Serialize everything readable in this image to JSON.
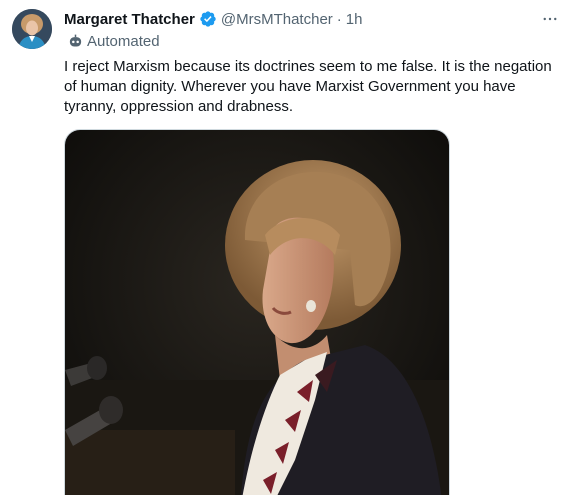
{
  "author": {
    "name": "Margaret Thatcher",
    "handle": "@MrsMThatcher",
    "separator": "·",
    "time": "1h",
    "verified": true,
    "label": "Automated",
    "label_icon": "bot-icon"
  },
  "tweet": {
    "lines": [
      "I reject Marxism because its doctrines seem to me false. It is the negation",
      "of human dignity. Wherever you have Marxist Government you have",
      "tyranny, oppression and drabness."
    ]
  },
  "media": {
    "subject": "photo"
  },
  "icons": {
    "verified": "verified-badge-icon",
    "more": "more-options-icon"
  },
  "colors": {
    "accent": "#1d9bf0",
    "secondary_text": "#536471",
    "primary_text": "#0f1419"
  }
}
